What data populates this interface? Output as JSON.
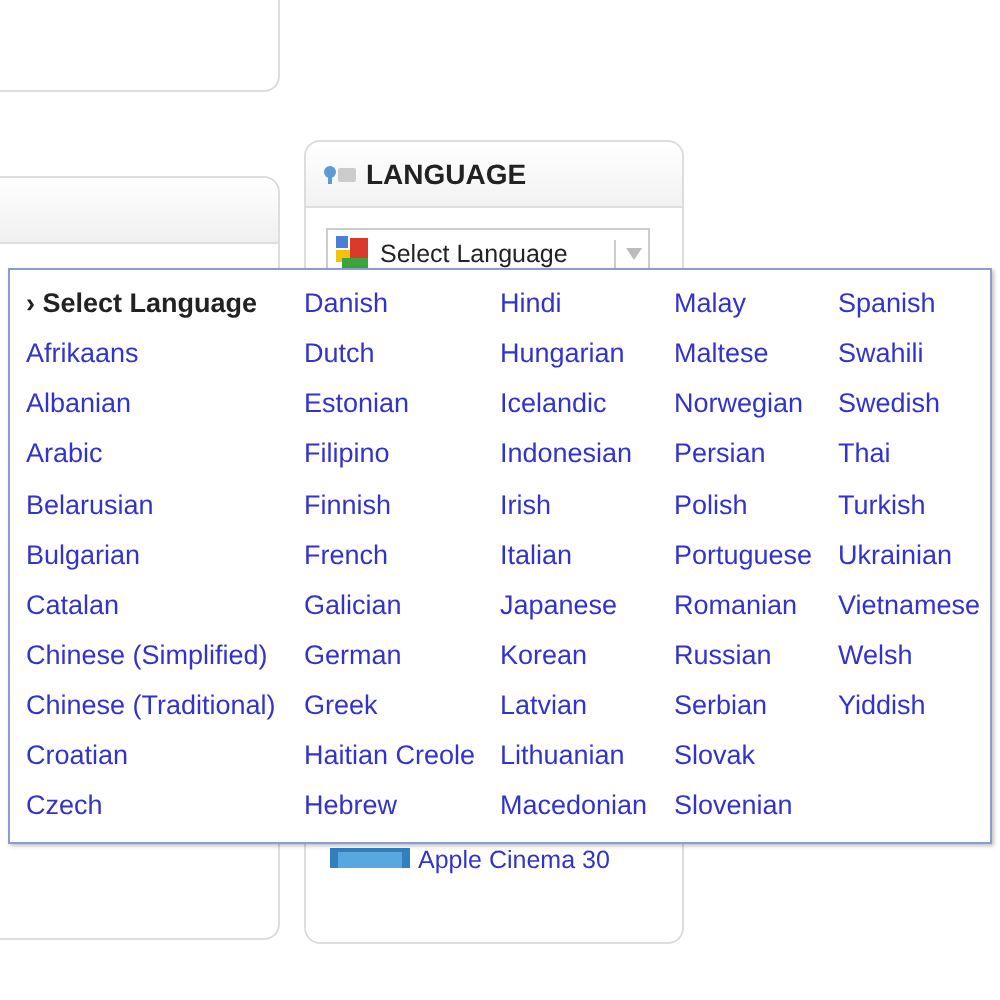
{
  "language_panel": {
    "title": "LANGUAGE",
    "select": {
      "value": "Select Language"
    }
  },
  "product": {
    "name": "Apple Cinema 30"
  },
  "language_menu": {
    "marker": "›",
    "items": [
      {
        "label": "Select Language",
        "selected": true
      },
      {
        "label": "Afrikaans",
        "selected": false
      },
      {
        "label": "Albanian",
        "selected": false
      },
      {
        "label": "Arabic",
        "selected": false
      },
      {
        "label": "Belarusian",
        "selected": false
      },
      {
        "label": "Bulgarian",
        "selected": false
      },
      {
        "label": "Catalan",
        "selected": false
      },
      {
        "label": "Chinese (Simplified)",
        "selected": false
      },
      {
        "label": "Chinese (Traditional)",
        "selected": false
      },
      {
        "label": "Croatian",
        "selected": false
      },
      {
        "label": "Czech",
        "selected": false
      },
      {
        "label": "Danish",
        "selected": false
      },
      {
        "label": "Dutch",
        "selected": false
      },
      {
        "label": "Estonian",
        "selected": false
      },
      {
        "label": "Filipino",
        "selected": false
      },
      {
        "label": "Finnish",
        "selected": false
      },
      {
        "label": "French",
        "selected": false
      },
      {
        "label": "Galician",
        "selected": false
      },
      {
        "label": "German",
        "selected": false
      },
      {
        "label": "Greek",
        "selected": false
      },
      {
        "label": "Haitian Creole",
        "selected": false
      },
      {
        "label": "Hebrew",
        "selected": false
      },
      {
        "label": "Hindi",
        "selected": false
      },
      {
        "label": "Hungarian",
        "selected": false
      },
      {
        "label": "Icelandic",
        "selected": false
      },
      {
        "label": "Indonesian",
        "selected": false
      },
      {
        "label": "Irish",
        "selected": false
      },
      {
        "label": "Italian",
        "selected": false
      },
      {
        "label": "Japanese",
        "selected": false
      },
      {
        "label": "Korean",
        "selected": false
      },
      {
        "label": "Latvian",
        "selected": false
      },
      {
        "label": "Lithuanian",
        "selected": false
      },
      {
        "label": "Macedonian",
        "selected": false
      },
      {
        "label": "Malay",
        "selected": false
      },
      {
        "label": "Maltese",
        "selected": false
      },
      {
        "label": "Norwegian",
        "selected": false
      },
      {
        "label": "Persian",
        "selected": false
      },
      {
        "label": "Polish",
        "selected": false
      },
      {
        "label": "Portuguese",
        "selected": false
      },
      {
        "label": "Romanian",
        "selected": false
      },
      {
        "label": "Russian",
        "selected": false
      },
      {
        "label": "Serbian",
        "selected": false
      },
      {
        "label": "Slovak",
        "selected": false
      },
      {
        "label": "Slovenian",
        "selected": false
      },
      {
        "label": "Spanish",
        "selected": false
      },
      {
        "label": "Swahili",
        "selected": false
      },
      {
        "label": "Swedish",
        "selected": false
      },
      {
        "label": "Thai",
        "selected": false
      },
      {
        "label": "Turkish",
        "selected": false
      },
      {
        "label": "Ukrainian",
        "selected": false
      },
      {
        "label": "Vietnamese",
        "selected": false
      },
      {
        "label": "Welsh",
        "selected": false
      },
      {
        "label": "Yiddish",
        "selected": false
      }
    ]
  }
}
